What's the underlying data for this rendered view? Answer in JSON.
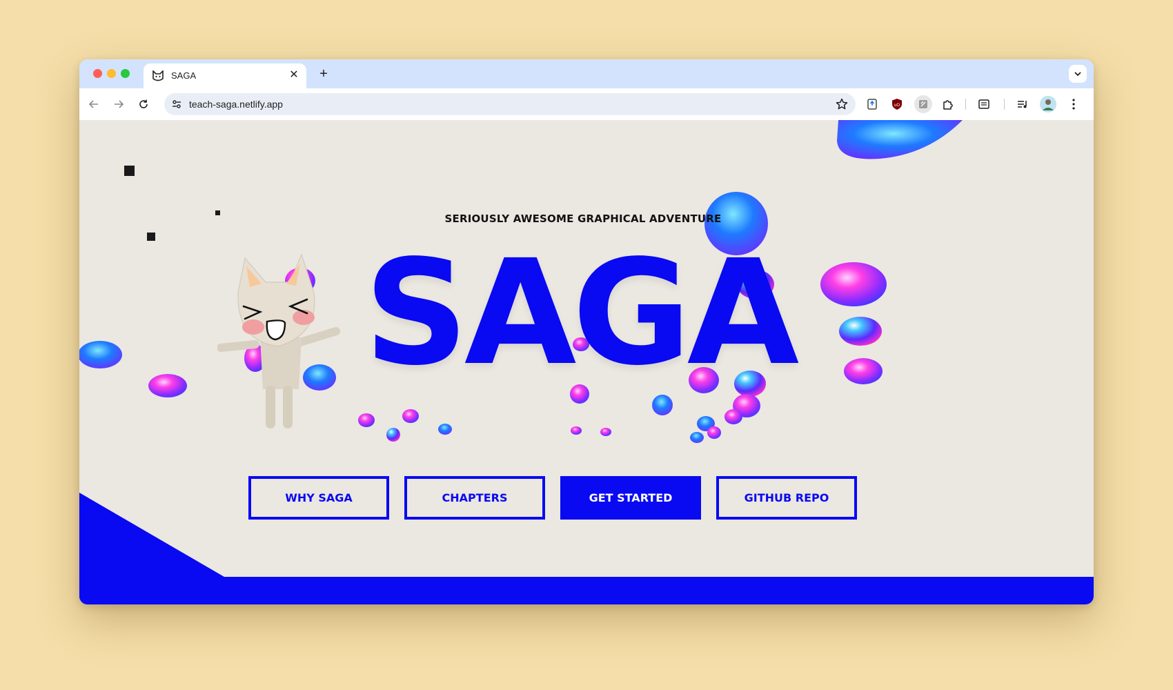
{
  "browser": {
    "tab": {
      "title": "SAGA",
      "close_glyph": "✕",
      "favicon": "cat-favicon-icon"
    },
    "new_tab_glyph": "+",
    "address": {
      "url": "teach-saga.netlify.app"
    },
    "icons": [
      "back-arrow-icon",
      "forward-arrow-icon",
      "reload-icon",
      "site-settings-icon",
      "bookmark-star-icon",
      "extension-icon",
      "ublock-icon",
      "extension-icon",
      "puzzle-icon",
      "reading-list-icon",
      "media-controls-icon",
      "profile-avatar-icon",
      "kebab-menu-icon",
      "tab-search-icon"
    ]
  },
  "page": {
    "subtitle": "SERIOUSLY AWESOME GRAPHICAL ADVENTURE",
    "title": "SAGA",
    "buttons": {
      "why_saga": "WHY SAGA",
      "chapters": "CHAPTERS",
      "get_started": "GET STARTED",
      "github_repo": "GITHUB REPO"
    }
  },
  "colors": {
    "brand_blue": "#0909f2",
    "page_bg": "#ebe7e1",
    "desktop_bg": "#f5dea9",
    "tabstrip_bg": "#d3e3fd"
  }
}
